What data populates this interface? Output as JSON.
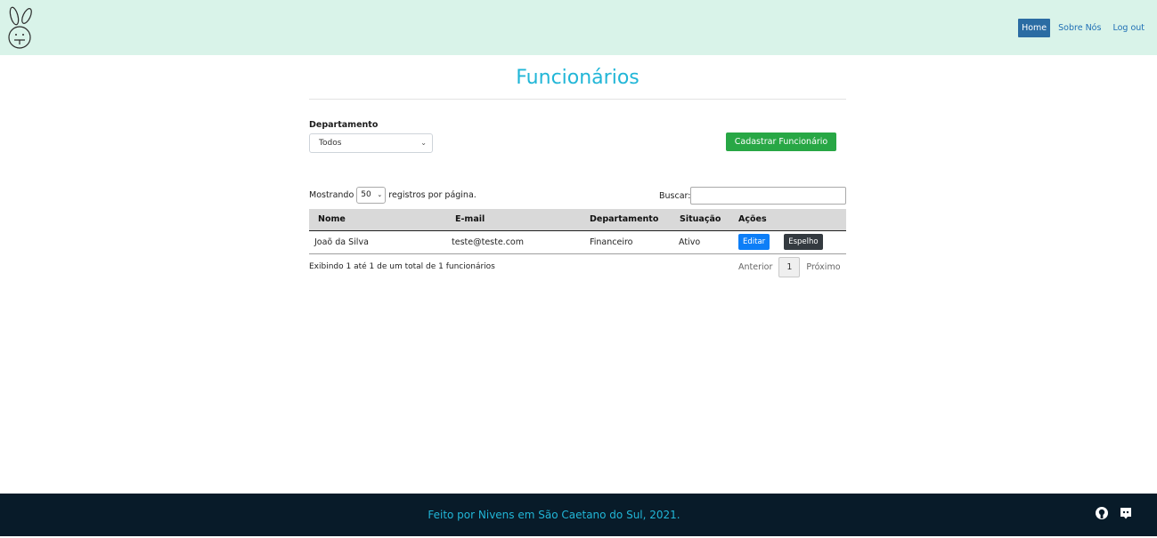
{
  "header": {
    "logo": "bunny-logo",
    "nav": [
      {
        "label": "Home",
        "active": true
      },
      {
        "label": "Sobre Nós",
        "active": false
      },
      {
        "label": "Log out",
        "active": false
      }
    ]
  },
  "page": {
    "title": "Funcionários",
    "department_label": "Departamento",
    "department_selected": "Todos",
    "create_button": "Cadastrar Funcionário"
  },
  "table_controls": {
    "show_prefix": "Mostrando",
    "page_length": "50",
    "show_suffix": "registros por página.",
    "search_label": "Buscar:",
    "search_value": ""
  },
  "table": {
    "headers": [
      "Nome",
      "E-mail",
      "Departamento",
      "Situação",
      "Ações"
    ],
    "rows": [
      {
        "nome": "Joaõ da Silva",
        "email": "teste@teste.com",
        "departamento": "Financeiro",
        "situacao": "Ativo",
        "edit_label": "Editar",
        "mirror_label": "Espelho"
      }
    ]
  },
  "footer_info": {
    "summary": "Exibindo 1 até 1 de um total de 1 funcionários",
    "prev": "Anterior",
    "current_page": "1",
    "next": "Próximo"
  },
  "footer": {
    "text": "Feito por Nivens em São Caetano do Sul, 2021.",
    "icons": [
      "github-icon",
      "discord-icon"
    ]
  },
  "colors": {
    "header_bg": "#d9f3e9",
    "accent": "#21b6d7",
    "success": "#28a745",
    "primary": "#0d7ef7",
    "dark": "#343a40",
    "footer_bg": "#081b29"
  }
}
